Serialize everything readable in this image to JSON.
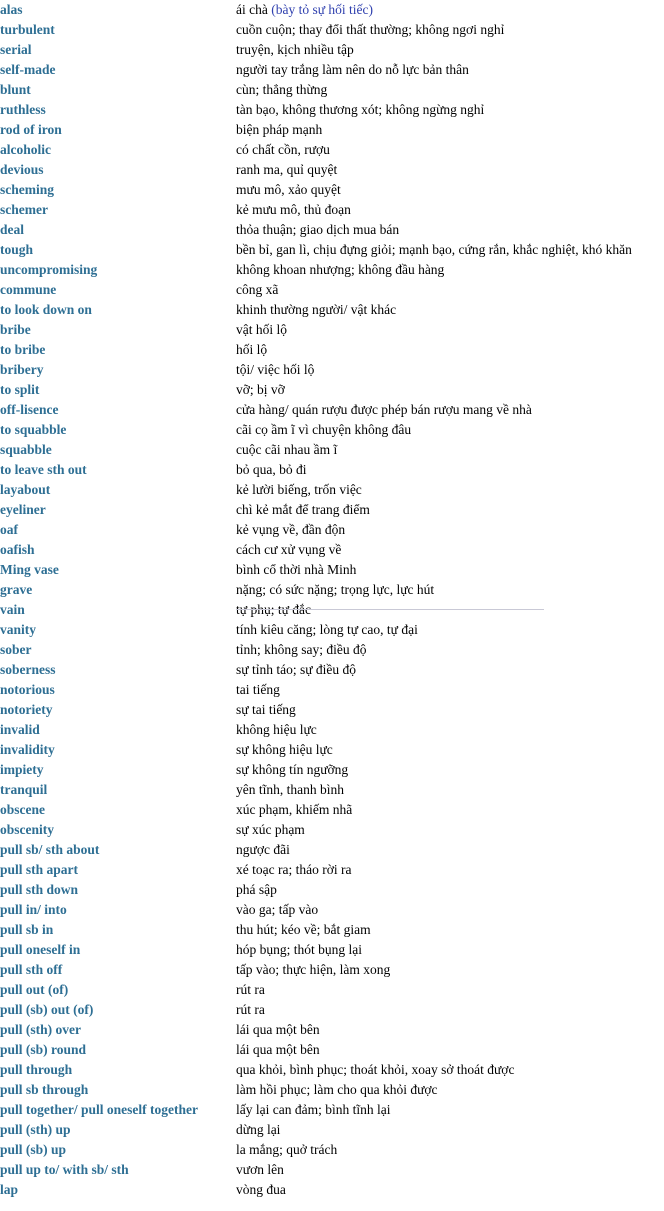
{
  "page": {
    "kind": "bilingual-vocabulary-list",
    "term_color": "#2e6f94",
    "definition_color": "#000000",
    "note_color": "#2e3fae",
    "background_color": "#ffffff"
  },
  "entries": [
    {
      "term": "alas",
      "definition": "ái chà (bày tỏ sự hối tiếc)",
      "note": "(bày tỏ sự hối tiếc)",
      "definition_plain": "ái chà "
    },
    {
      "term": "turbulent",
      "definition": "cuồn cuộn; thay đổi thất thường; không ngơi nghỉ"
    },
    {
      "term": "serial",
      "definition": "truyện, kịch nhiều tập"
    },
    {
      "term": "self-made",
      "definition": "người tay trắng làm nên do nỗ lực bản thân"
    },
    {
      "term": "blunt",
      "definition": "cùn; thẳng thừng"
    },
    {
      "term": "ruthless",
      "definition": "tàn bạo, không thương xót; không ngừng nghỉ"
    },
    {
      "term": "rod of iron",
      "definition": "biện pháp mạnh"
    },
    {
      "term": "alcoholic",
      "definition": "có chất cồn, rượu"
    },
    {
      "term": "devious",
      "definition": "ranh ma, quỉ quyệt"
    },
    {
      "term": "scheming",
      "definition": "mưu mô, xảo quyệt"
    },
    {
      "term": "schemer",
      "definition": "kẻ mưu mô, thủ đoạn"
    },
    {
      "term": "deal",
      "definition": "thỏa thuận; giao dịch mua bán"
    },
    {
      "term": "tough",
      "definition": "bền bỉ, gan lì, chịu đựng giỏi; mạnh bạo, cứng rắn, khắc nghiệt, khó khăn"
    },
    {
      "term": "uncompromising",
      "definition": "không khoan nhượng; không đầu hàng"
    },
    {
      "term": "commune",
      "definition": "công xã"
    },
    {
      "term": "to look down on",
      "definition": "khinh thường người/ vật khác"
    },
    {
      "term": "bribe",
      "definition": "vật hối lộ"
    },
    {
      "term": "to bribe",
      "definition": "hối lộ"
    },
    {
      "term": "bribery",
      "definition": "tội/ việc hối lộ"
    },
    {
      "term": "to split",
      "definition": "vỡ; bị vỡ"
    },
    {
      "term": "off-lisence",
      "definition": "cửa hàng/ quán rượu được phép bán rượu mang về nhà"
    },
    {
      "term": "to squabble",
      "definition": "cãi cọ ầm ĩ vì chuyện không đâu"
    },
    {
      "term": "squabble",
      "definition": "cuộc cãi nhau ầm ĩ"
    },
    {
      "term": "to leave sth out",
      "definition": "bỏ qua, bỏ đi"
    },
    {
      "term": "layabout",
      "definition": "kẻ lười biếng, trốn việc"
    },
    {
      "term": "eyeliner",
      "definition": "chì kẻ mắt để trang điểm"
    },
    {
      "term": "oaf",
      "definition": "kẻ vụng về, đần độn"
    },
    {
      "term": "oafish",
      "definition": "cách cư xử vụng về"
    },
    {
      "term": "Ming vase",
      "definition": "bình cổ thời nhà Minh"
    },
    {
      "term": "grave",
      "definition": "nặng; có sức nặng; trọng lực, lực hút"
    },
    {
      "term": "vain",
      "definition": "tự phụ; tự đắc",
      "artifact": true
    },
    {
      "term": "vanity",
      "definition": "tính kiêu căng; lòng tự cao, tự đại"
    },
    {
      "term": "sober",
      "definition": "tỉnh; không say; điều độ"
    },
    {
      "term": "soberness",
      "definition": "sự tỉnh táo; sự điều độ"
    },
    {
      "term": "notorious",
      "definition": "tai tiếng"
    },
    {
      "term": "notoriety",
      "definition": "sự tai tiếng"
    },
    {
      "term": "invalid",
      "definition": "không hiệu lực"
    },
    {
      "term": "invalidity",
      "definition": "sự không hiệu lực"
    },
    {
      "term": "impiety",
      "definition": "sự không tín ngưỡng"
    },
    {
      "term": "tranquil",
      "definition": "yên tĩnh, thanh bình"
    },
    {
      "term": "obscene",
      "definition": "xúc phạm, khiếm nhã"
    },
    {
      "term": "obscenity",
      "definition": "sự xúc phạm"
    },
    {
      "term": "pull sb/ sth about",
      "definition": "ngược đãi"
    },
    {
      "term": "pull sth apart",
      "definition": "xé toạc ra; tháo rời ra"
    },
    {
      "term": "pull sth down",
      "definition": "phá sập"
    },
    {
      "term": "pull in/ into",
      "definition": "vào ga; tấp vào"
    },
    {
      "term": "pull sb in",
      "definition": "thu hút; kéo về; bắt giam"
    },
    {
      "term": "pull oneself in",
      "definition": "hóp bụng; thót bụng lại"
    },
    {
      "term": "pull sth off",
      "definition": "tấp vào; thực hiện, làm xong"
    },
    {
      "term": "pull out (of)",
      "definition": "rút ra"
    },
    {
      "term": "pull (sb) out (of)",
      "definition": "rút ra"
    },
    {
      "term": "pull (sth) over",
      "definition": "lái qua một bên"
    },
    {
      "term": "pull (sb) round",
      "definition": "lái qua một bên"
    },
    {
      "term": "pull through",
      "definition": "qua khỏi, bình phục; thoát khỏi, xoay sở thoát được"
    },
    {
      "term": "pull sb through",
      "definition": "làm hồi phục; làm cho qua khỏi được"
    },
    {
      "term": "pull together/ pull oneself together",
      "definition": "lấy lại can đảm; bình tĩnh lại",
      "wide": true
    },
    {
      "term": "pull (sth) up",
      "definition": "dừng lại"
    },
    {
      "term": "pull (sb) up",
      "definition": "la mắng; quở trách"
    },
    {
      "term": "pull up to/ with sb/ sth",
      "definition": "vươn lên"
    },
    {
      "term": "lap",
      "definition": "vòng đua"
    }
  ]
}
